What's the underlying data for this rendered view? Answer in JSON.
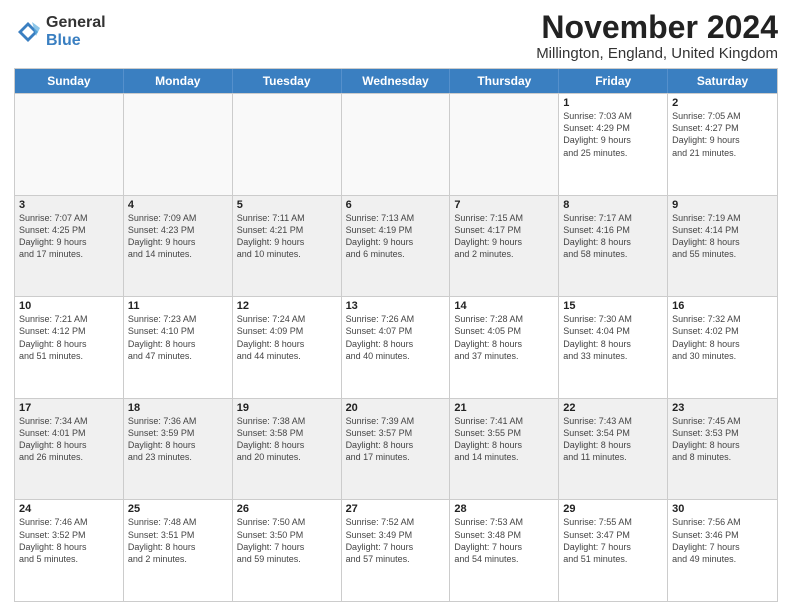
{
  "logo": {
    "general": "General",
    "blue": "Blue"
  },
  "title": "November 2024",
  "location": "Millington, England, United Kingdom",
  "header_days": [
    "Sunday",
    "Monday",
    "Tuesday",
    "Wednesday",
    "Thursday",
    "Friday",
    "Saturday"
  ],
  "rows": [
    [
      {
        "day": "",
        "info": "",
        "empty": true
      },
      {
        "day": "",
        "info": "",
        "empty": true
      },
      {
        "day": "",
        "info": "",
        "empty": true
      },
      {
        "day": "",
        "info": "",
        "empty": true
      },
      {
        "day": "",
        "info": "",
        "empty": true
      },
      {
        "day": "1",
        "info": "Sunrise: 7:03 AM\nSunset: 4:29 PM\nDaylight: 9 hours\nand 25 minutes.",
        "empty": false
      },
      {
        "day": "2",
        "info": "Sunrise: 7:05 AM\nSunset: 4:27 PM\nDaylight: 9 hours\nand 21 minutes.",
        "empty": false
      }
    ],
    [
      {
        "day": "3",
        "info": "Sunrise: 7:07 AM\nSunset: 4:25 PM\nDaylight: 9 hours\nand 17 minutes.",
        "empty": false
      },
      {
        "day": "4",
        "info": "Sunrise: 7:09 AM\nSunset: 4:23 PM\nDaylight: 9 hours\nand 14 minutes.",
        "empty": false
      },
      {
        "day": "5",
        "info": "Sunrise: 7:11 AM\nSunset: 4:21 PM\nDaylight: 9 hours\nand 10 minutes.",
        "empty": false
      },
      {
        "day": "6",
        "info": "Sunrise: 7:13 AM\nSunset: 4:19 PM\nDaylight: 9 hours\nand 6 minutes.",
        "empty": false
      },
      {
        "day": "7",
        "info": "Sunrise: 7:15 AM\nSunset: 4:17 PM\nDaylight: 9 hours\nand 2 minutes.",
        "empty": false
      },
      {
        "day": "8",
        "info": "Sunrise: 7:17 AM\nSunset: 4:16 PM\nDaylight: 8 hours\nand 58 minutes.",
        "empty": false
      },
      {
        "day": "9",
        "info": "Sunrise: 7:19 AM\nSunset: 4:14 PM\nDaylight: 8 hours\nand 55 minutes.",
        "empty": false
      }
    ],
    [
      {
        "day": "10",
        "info": "Sunrise: 7:21 AM\nSunset: 4:12 PM\nDaylight: 8 hours\nand 51 minutes.",
        "empty": false
      },
      {
        "day": "11",
        "info": "Sunrise: 7:23 AM\nSunset: 4:10 PM\nDaylight: 8 hours\nand 47 minutes.",
        "empty": false
      },
      {
        "day": "12",
        "info": "Sunrise: 7:24 AM\nSunset: 4:09 PM\nDaylight: 8 hours\nand 44 minutes.",
        "empty": false
      },
      {
        "day": "13",
        "info": "Sunrise: 7:26 AM\nSunset: 4:07 PM\nDaylight: 8 hours\nand 40 minutes.",
        "empty": false
      },
      {
        "day": "14",
        "info": "Sunrise: 7:28 AM\nSunset: 4:05 PM\nDaylight: 8 hours\nand 37 minutes.",
        "empty": false
      },
      {
        "day": "15",
        "info": "Sunrise: 7:30 AM\nSunset: 4:04 PM\nDaylight: 8 hours\nand 33 minutes.",
        "empty": false
      },
      {
        "day": "16",
        "info": "Sunrise: 7:32 AM\nSunset: 4:02 PM\nDaylight: 8 hours\nand 30 minutes.",
        "empty": false
      }
    ],
    [
      {
        "day": "17",
        "info": "Sunrise: 7:34 AM\nSunset: 4:01 PM\nDaylight: 8 hours\nand 26 minutes.",
        "empty": false
      },
      {
        "day": "18",
        "info": "Sunrise: 7:36 AM\nSunset: 3:59 PM\nDaylight: 8 hours\nand 23 minutes.",
        "empty": false
      },
      {
        "day": "19",
        "info": "Sunrise: 7:38 AM\nSunset: 3:58 PM\nDaylight: 8 hours\nand 20 minutes.",
        "empty": false
      },
      {
        "day": "20",
        "info": "Sunrise: 7:39 AM\nSunset: 3:57 PM\nDaylight: 8 hours\nand 17 minutes.",
        "empty": false
      },
      {
        "day": "21",
        "info": "Sunrise: 7:41 AM\nSunset: 3:55 PM\nDaylight: 8 hours\nand 14 minutes.",
        "empty": false
      },
      {
        "day": "22",
        "info": "Sunrise: 7:43 AM\nSunset: 3:54 PM\nDaylight: 8 hours\nand 11 minutes.",
        "empty": false
      },
      {
        "day": "23",
        "info": "Sunrise: 7:45 AM\nSunset: 3:53 PM\nDaylight: 8 hours\nand 8 minutes.",
        "empty": false
      }
    ],
    [
      {
        "day": "24",
        "info": "Sunrise: 7:46 AM\nSunset: 3:52 PM\nDaylight: 8 hours\nand 5 minutes.",
        "empty": false
      },
      {
        "day": "25",
        "info": "Sunrise: 7:48 AM\nSunset: 3:51 PM\nDaylight: 8 hours\nand 2 minutes.",
        "empty": false
      },
      {
        "day": "26",
        "info": "Sunrise: 7:50 AM\nSunset: 3:50 PM\nDaylight: 7 hours\nand 59 minutes.",
        "empty": false
      },
      {
        "day": "27",
        "info": "Sunrise: 7:52 AM\nSunset: 3:49 PM\nDaylight: 7 hours\nand 57 minutes.",
        "empty": false
      },
      {
        "day": "28",
        "info": "Sunrise: 7:53 AM\nSunset: 3:48 PM\nDaylight: 7 hours\nand 54 minutes.",
        "empty": false
      },
      {
        "day": "29",
        "info": "Sunrise: 7:55 AM\nSunset: 3:47 PM\nDaylight: 7 hours\nand 51 minutes.",
        "empty": false
      },
      {
        "day": "30",
        "info": "Sunrise: 7:56 AM\nSunset: 3:46 PM\nDaylight: 7 hours\nand 49 minutes.",
        "empty": false
      }
    ]
  ]
}
